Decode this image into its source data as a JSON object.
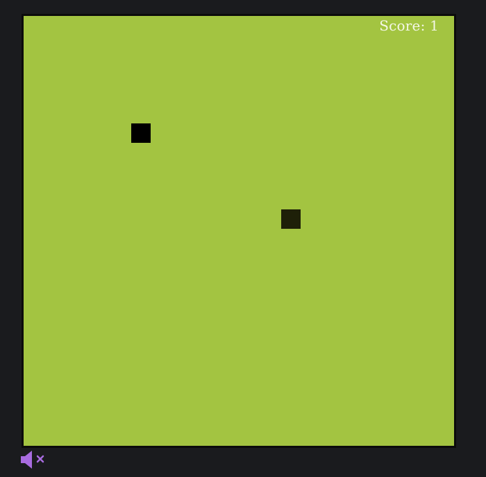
{
  "hud": {
    "score_text": "Score: 1",
    "score": 1
  },
  "game": {
    "board_color": "#a3c441",
    "border_color": "#0b0b0b",
    "snake_color": "#000000",
    "food_color": "#1e2008",
    "background_color": "#1a1b1e"
  },
  "controls": {
    "sound_icon": "speaker-muted-icon",
    "sound_icon_color": "#a86ce0",
    "muted": true
  }
}
